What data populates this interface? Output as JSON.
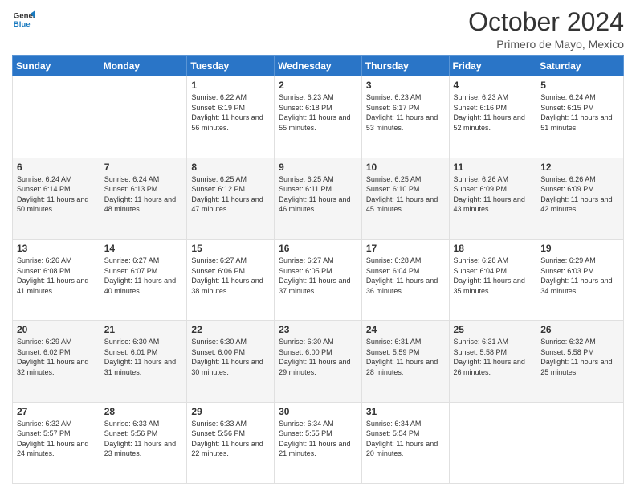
{
  "logo": {
    "line1": "General",
    "line2": "Blue"
  },
  "title": "October 2024",
  "location": "Primero de Mayo, Mexico",
  "days_of_week": [
    "Sunday",
    "Monday",
    "Tuesday",
    "Wednesday",
    "Thursday",
    "Friday",
    "Saturday"
  ],
  "weeks": [
    [
      {
        "num": "",
        "sunrise": "",
        "sunset": "",
        "daylight": ""
      },
      {
        "num": "",
        "sunrise": "",
        "sunset": "",
        "daylight": ""
      },
      {
        "num": "1",
        "sunrise": "Sunrise: 6:22 AM",
        "sunset": "Sunset: 6:19 PM",
        "daylight": "Daylight: 11 hours and 56 minutes."
      },
      {
        "num": "2",
        "sunrise": "Sunrise: 6:23 AM",
        "sunset": "Sunset: 6:18 PM",
        "daylight": "Daylight: 11 hours and 55 minutes."
      },
      {
        "num": "3",
        "sunrise": "Sunrise: 6:23 AM",
        "sunset": "Sunset: 6:17 PM",
        "daylight": "Daylight: 11 hours and 53 minutes."
      },
      {
        "num": "4",
        "sunrise": "Sunrise: 6:23 AM",
        "sunset": "Sunset: 6:16 PM",
        "daylight": "Daylight: 11 hours and 52 minutes."
      },
      {
        "num": "5",
        "sunrise": "Sunrise: 6:24 AM",
        "sunset": "Sunset: 6:15 PM",
        "daylight": "Daylight: 11 hours and 51 minutes."
      }
    ],
    [
      {
        "num": "6",
        "sunrise": "Sunrise: 6:24 AM",
        "sunset": "Sunset: 6:14 PM",
        "daylight": "Daylight: 11 hours and 50 minutes."
      },
      {
        "num": "7",
        "sunrise": "Sunrise: 6:24 AM",
        "sunset": "Sunset: 6:13 PM",
        "daylight": "Daylight: 11 hours and 48 minutes."
      },
      {
        "num": "8",
        "sunrise": "Sunrise: 6:25 AM",
        "sunset": "Sunset: 6:12 PM",
        "daylight": "Daylight: 11 hours and 47 minutes."
      },
      {
        "num": "9",
        "sunrise": "Sunrise: 6:25 AM",
        "sunset": "Sunset: 6:11 PM",
        "daylight": "Daylight: 11 hours and 46 minutes."
      },
      {
        "num": "10",
        "sunrise": "Sunrise: 6:25 AM",
        "sunset": "Sunset: 6:10 PM",
        "daylight": "Daylight: 11 hours and 45 minutes."
      },
      {
        "num": "11",
        "sunrise": "Sunrise: 6:26 AM",
        "sunset": "Sunset: 6:09 PM",
        "daylight": "Daylight: 11 hours and 43 minutes."
      },
      {
        "num": "12",
        "sunrise": "Sunrise: 6:26 AM",
        "sunset": "Sunset: 6:09 PM",
        "daylight": "Daylight: 11 hours and 42 minutes."
      }
    ],
    [
      {
        "num": "13",
        "sunrise": "Sunrise: 6:26 AM",
        "sunset": "Sunset: 6:08 PM",
        "daylight": "Daylight: 11 hours and 41 minutes."
      },
      {
        "num": "14",
        "sunrise": "Sunrise: 6:27 AM",
        "sunset": "Sunset: 6:07 PM",
        "daylight": "Daylight: 11 hours and 40 minutes."
      },
      {
        "num": "15",
        "sunrise": "Sunrise: 6:27 AM",
        "sunset": "Sunset: 6:06 PM",
        "daylight": "Daylight: 11 hours and 38 minutes."
      },
      {
        "num": "16",
        "sunrise": "Sunrise: 6:27 AM",
        "sunset": "Sunset: 6:05 PM",
        "daylight": "Daylight: 11 hours and 37 minutes."
      },
      {
        "num": "17",
        "sunrise": "Sunrise: 6:28 AM",
        "sunset": "Sunset: 6:04 PM",
        "daylight": "Daylight: 11 hours and 36 minutes."
      },
      {
        "num": "18",
        "sunrise": "Sunrise: 6:28 AM",
        "sunset": "Sunset: 6:04 PM",
        "daylight": "Daylight: 11 hours and 35 minutes."
      },
      {
        "num": "19",
        "sunrise": "Sunrise: 6:29 AM",
        "sunset": "Sunset: 6:03 PM",
        "daylight": "Daylight: 11 hours and 34 minutes."
      }
    ],
    [
      {
        "num": "20",
        "sunrise": "Sunrise: 6:29 AM",
        "sunset": "Sunset: 6:02 PM",
        "daylight": "Daylight: 11 hours and 32 minutes."
      },
      {
        "num": "21",
        "sunrise": "Sunrise: 6:30 AM",
        "sunset": "Sunset: 6:01 PM",
        "daylight": "Daylight: 11 hours and 31 minutes."
      },
      {
        "num": "22",
        "sunrise": "Sunrise: 6:30 AM",
        "sunset": "Sunset: 6:00 PM",
        "daylight": "Daylight: 11 hours and 30 minutes."
      },
      {
        "num": "23",
        "sunrise": "Sunrise: 6:30 AM",
        "sunset": "Sunset: 6:00 PM",
        "daylight": "Daylight: 11 hours and 29 minutes."
      },
      {
        "num": "24",
        "sunrise": "Sunrise: 6:31 AM",
        "sunset": "Sunset: 5:59 PM",
        "daylight": "Daylight: 11 hours and 28 minutes."
      },
      {
        "num": "25",
        "sunrise": "Sunrise: 6:31 AM",
        "sunset": "Sunset: 5:58 PM",
        "daylight": "Daylight: 11 hours and 26 minutes."
      },
      {
        "num": "26",
        "sunrise": "Sunrise: 6:32 AM",
        "sunset": "Sunset: 5:58 PM",
        "daylight": "Daylight: 11 hours and 25 minutes."
      }
    ],
    [
      {
        "num": "27",
        "sunrise": "Sunrise: 6:32 AM",
        "sunset": "Sunset: 5:57 PM",
        "daylight": "Daylight: 11 hours and 24 minutes."
      },
      {
        "num": "28",
        "sunrise": "Sunrise: 6:33 AM",
        "sunset": "Sunset: 5:56 PM",
        "daylight": "Daylight: 11 hours and 23 minutes."
      },
      {
        "num": "29",
        "sunrise": "Sunrise: 6:33 AM",
        "sunset": "Sunset: 5:56 PM",
        "daylight": "Daylight: 11 hours and 22 minutes."
      },
      {
        "num": "30",
        "sunrise": "Sunrise: 6:34 AM",
        "sunset": "Sunset: 5:55 PM",
        "daylight": "Daylight: 11 hours and 21 minutes."
      },
      {
        "num": "31",
        "sunrise": "Sunrise: 6:34 AM",
        "sunset": "Sunset: 5:54 PM",
        "daylight": "Daylight: 11 hours and 20 minutes."
      },
      {
        "num": "",
        "sunrise": "",
        "sunset": "",
        "daylight": ""
      },
      {
        "num": "",
        "sunrise": "",
        "sunset": "",
        "daylight": ""
      }
    ]
  ]
}
